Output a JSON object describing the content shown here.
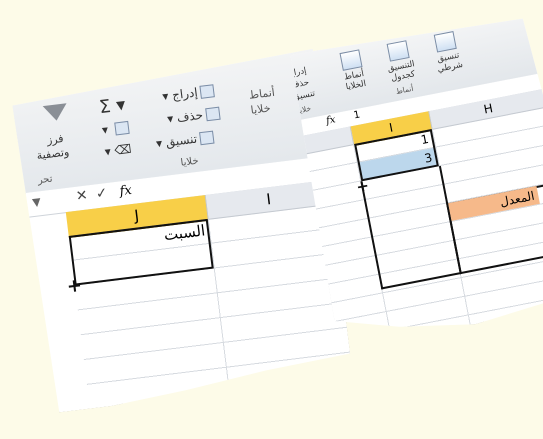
{
  "left_fragment": {
    "ribbon": {
      "insert_label": "إدراج",
      "delete_label": "حذف",
      "format_label": "تنسيق",
      "cells_group": "خلايا",
      "styles_label": "أنماط",
      "styles_label2": "خلايا",
      "sort_filter_label": "فرز",
      "sort_filter_label2": "وتصفية",
      "editing_group": "تحر"
    },
    "formula_bar": {
      "fx": "fx",
      "cancel": "✕",
      "enter": "✓",
      "dropdown": "▼"
    },
    "columns": [
      "J",
      "I"
    ],
    "selected_column": "J",
    "cell_value": "السبت"
  },
  "right_fragment": {
    "ribbon": {
      "insert_label": "إدراج",
      "delete_label": "حذف",
      "format_label": "تنسيق",
      "cells_group": "خلايا",
      "cell_styles": "أنماط الخلايا",
      "format_as_table": "التنسيق كجدول",
      "conditional_formatting": "تنسيق شرطي",
      "styles_group": "أنماط"
    },
    "formula_bar": {
      "fx": "fx",
      "value": "1"
    },
    "columns": [
      "H",
      "I"
    ],
    "selected_column": "I",
    "cells": [
      "1",
      "3"
    ],
    "average_label": "المعدل"
  }
}
